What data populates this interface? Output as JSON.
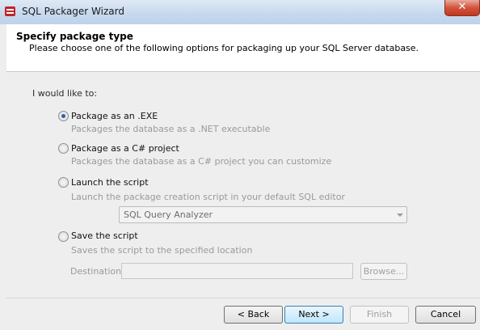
{
  "window": {
    "title": "SQL Packager Wizard",
    "close_glyph": "✕"
  },
  "header": {
    "title": "Specify package type",
    "subtitle": "Please choose one of the following options for packaging up your SQL Server database."
  },
  "lead_text": "I would like to:",
  "options": [
    {
      "label": "Package as an .EXE",
      "description": "Packages the database as a .NET executable",
      "selected": true
    },
    {
      "label": "Package as a C# project",
      "description": "Packages the database as a C# project you can customize",
      "selected": false
    },
    {
      "label": "Launch the script",
      "description": "Launch the package creation script in your default SQL editor",
      "selected": false
    },
    {
      "label": "Save the script",
      "description": "Saves the script to the specified location",
      "selected": false
    }
  ],
  "editor_select": {
    "value": "SQL Query Analyzer"
  },
  "destination": {
    "label": "Destination:",
    "value": ""
  },
  "browse_label": "Browse...",
  "buttons": {
    "back": "< Back",
    "next": "Next >",
    "finish": "Finish",
    "cancel": "Cancel"
  }
}
